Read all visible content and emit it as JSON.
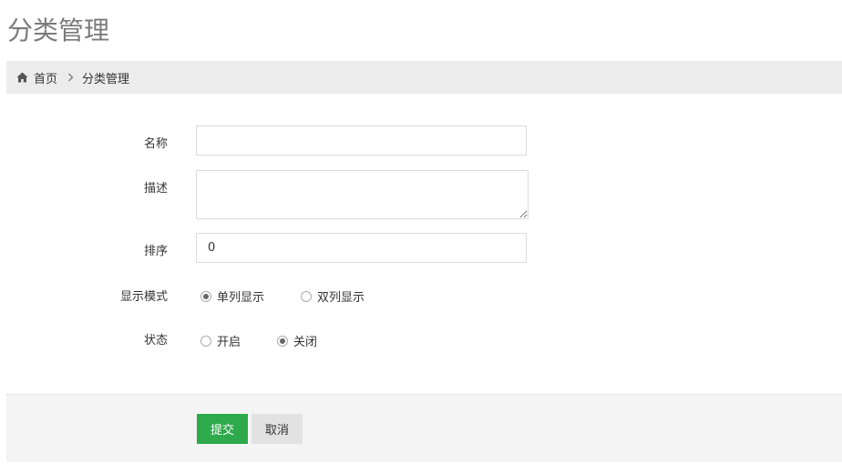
{
  "page": {
    "title": "分类管理"
  },
  "breadcrumb": {
    "home": "首页",
    "current": "分类管理"
  },
  "form": {
    "name": {
      "label": "名称",
      "value": "",
      "placeholder": ""
    },
    "description": {
      "label": "描述",
      "value": ""
    },
    "sort": {
      "label": "排序",
      "value": "0"
    },
    "display_mode": {
      "label": "显示模式",
      "options": [
        "单列显示",
        "双列显示"
      ],
      "selected": "单列显示"
    },
    "status": {
      "label": "状态",
      "options": [
        "开启",
        "关闭"
      ],
      "selected": "关闭"
    }
  },
  "actions": {
    "submit_label": "提交",
    "cancel_label": "取消",
    "submit_color": "#2daa4b",
    "cancel_color": "#e2e2e2"
  },
  "icons": {
    "home": "home-icon",
    "separator": "chevron-right-icon"
  }
}
